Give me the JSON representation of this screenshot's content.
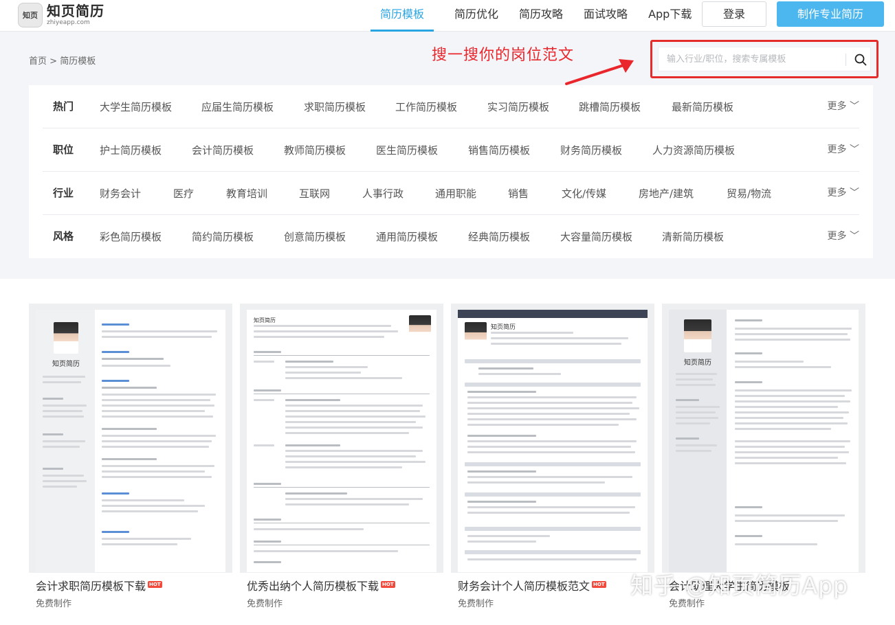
{
  "header": {
    "logo_badge": "知页",
    "logo_name": "知页简历",
    "logo_domain": "zhiyeapp.com",
    "nav": [
      {
        "label": "简历模板",
        "active": true
      },
      {
        "label": "简历优化",
        "active": false
      },
      {
        "label": "简历攻略",
        "active": false
      },
      {
        "label": "面试攻略",
        "active": false
      },
      {
        "label": "App下载",
        "active": false
      }
    ],
    "login_label": "登录",
    "make_label": "制作专业简历"
  },
  "breadcrumb": {
    "home": "首页",
    "separator": ">",
    "current": "简历模板"
  },
  "annotation": "搜一搜你的岗位范文",
  "search": {
    "placeholder": "输入行业/职位，搜索专属模板"
  },
  "filters": [
    {
      "label": "热门",
      "items": [
        "大学生简历模板",
        "应届生简历模板",
        "求职简历模板",
        "工作简历模板",
        "实习简历模板",
        "跳槽简历模板",
        "最新简历模板"
      ],
      "more": "更多"
    },
    {
      "label": "职位",
      "items": [
        "护士简历模板",
        "会计简历模板",
        "教师简历模板",
        "医生简历模板",
        "销售简历模板",
        "财务简历模板",
        "人力资源简历模板"
      ],
      "more": "更多"
    },
    {
      "label": "行业",
      "items": [
        "财务会计",
        "医疗",
        "教育培训",
        "互联网",
        "人事行政",
        "通用职能",
        "销售",
        "文化/传媒",
        "房地产/建筑",
        "贸易/物流"
      ],
      "more": "更多"
    },
    {
      "label": "风格",
      "items": [
        "彩色简历模板",
        "简约简历模板",
        "创意简历模板",
        "通用简历模板",
        "经典简历模板",
        "大容量简历模板",
        "清新简历模板"
      ],
      "more": "更多"
    }
  ],
  "cards": [
    {
      "title": "会计求职简历模板下载",
      "badge": "HOT",
      "subtitle": "免费制作",
      "resume_name": "知页简历"
    },
    {
      "title": "优秀出纳个人简历模板下载",
      "badge": "HOT",
      "subtitle": "免费制作",
      "resume_name": "知页简历"
    },
    {
      "title": "财务会计个人简历模板范文",
      "badge": "HOT",
      "subtitle": "免费制作",
      "resume_name": "知页简历"
    },
    {
      "title": "会计助理大学生简历模板",
      "badge": "",
      "subtitle": "免费制作",
      "resume_name": "知页简历"
    }
  ],
  "watermark": "知乎 @知页简历App",
  "colors": {
    "accent": "#2aa5e4",
    "button": "#4cb6ef",
    "annotation_red": "#e8262b",
    "hot": "#f04b3c"
  }
}
